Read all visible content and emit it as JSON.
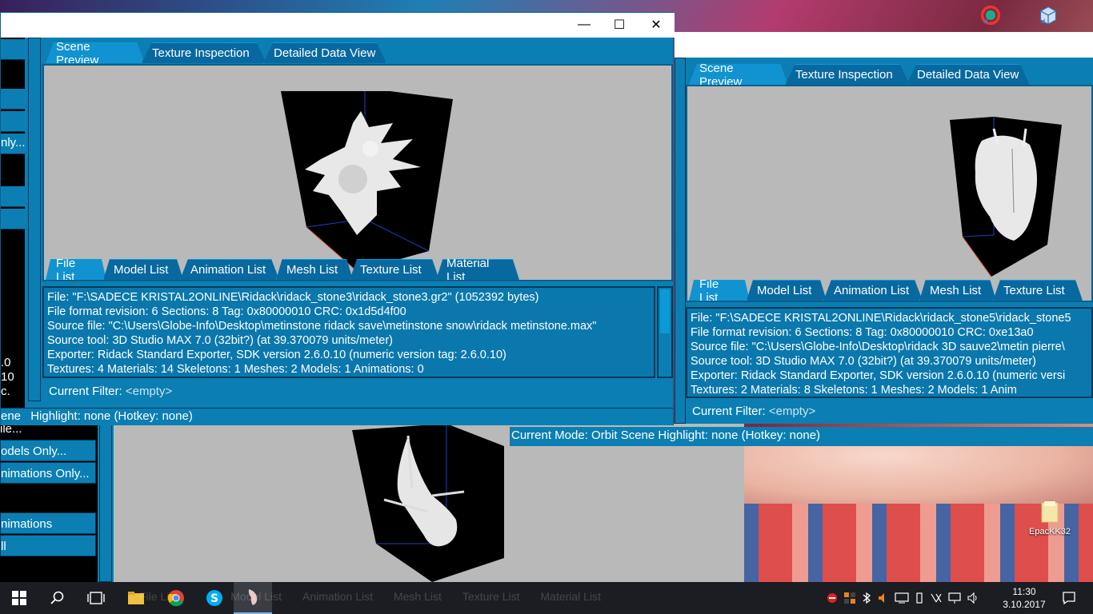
{
  "desktop": {
    "icon_label": "EpacKK32"
  },
  "main_window": {
    "minimize": "—",
    "maximize": "☐",
    "close": "✕",
    "top_tabs": [
      "Scene Preview",
      "Texture Inspection",
      "Detailed Data View"
    ],
    "list_tabs": [
      "File List",
      "Model List",
      "Animation List",
      "Mesh List",
      "Texture List",
      "Material List"
    ],
    "info_lines": [
      "File: \"F:\\SADECE KRISTAL2ONLINE\\Ridack\\ridack_stone3\\ridack_stone3.gr2\" (1052392 bytes)",
      "File format revision: 6    Sections: 8    Tag: 0x80000010    CRC: 0x1d5d4f00",
      "Source file: \"C:\\Users\\Globe-Info\\Desktop\\metinstone ridack save\\metinstone snow\\ridack metinstone.max\"",
      "Source tool: 3D Studio MAX 7.0 (32bit?) (at 39.370079 units/meter)",
      "Exporter: Ridack Standard Exporter, SDK version 2.6.0.10 (numeric version tag: 2.6.0.10)",
      "Textures: 4     Materials: 14     Skeletons: 1     Meshes: 2     Models: 1     Animations: 0"
    ],
    "filter_label": "Current Filter:",
    "filter_value": "<empty>",
    "status_prefix": "ene",
    "status_text": "Highlight: none (Hotkey: none)",
    "sidebar_texts": [
      "nly...",
      ".0",
      "10",
      "c."
    ]
  },
  "right_window": {
    "top_tabs": [
      "Scene Preview",
      "Texture Inspection",
      "Detailed Data View"
    ],
    "list_tabs": [
      "File List",
      "Model List",
      "Animation List",
      "Mesh List",
      "Texture List"
    ],
    "info_lines": [
      "File: \"F:\\SADECE KRISTAL2ONLINE\\Ridack\\ridack_stone5\\ridack_stone5",
      "File format revision: 6    Sections: 8    Tag: 0x80000010    CRC: 0xe13a0",
      "Source file: \"C:\\Users\\Globe-Info\\Desktop\\ridack 3D sauve2\\metin pierre\\",
      "Source tool: 3D Studio MAX 7.0 (32bit?) (at 39.370079 units/meter)",
      "Exporter: Ridack Standard Exporter, SDK version 2.6.0.10 (numeric versi",
      "Textures: 2     Materials: 8     Skeletons: 1     Meshes: 2     Models: 1     Anim"
    ],
    "filter_label": "Current Filter:",
    "filter_value": "<empty>",
    "status_text": "Current Mode: Orbit Scene    Highlight: none (Hotkey: none)"
  },
  "back_window": {
    "buttons": [
      "odels Only...",
      "nimations Only...",
      "nimations",
      "ll"
    ],
    "partial": "ile...",
    "ghost_tabs": [
      "File List",
      "Model List",
      "Animation List",
      "Mesh List",
      "Texture List",
      "Material List"
    ]
  },
  "taskbar": {
    "time": "11:30",
    "date": "3.10.2017"
  }
}
